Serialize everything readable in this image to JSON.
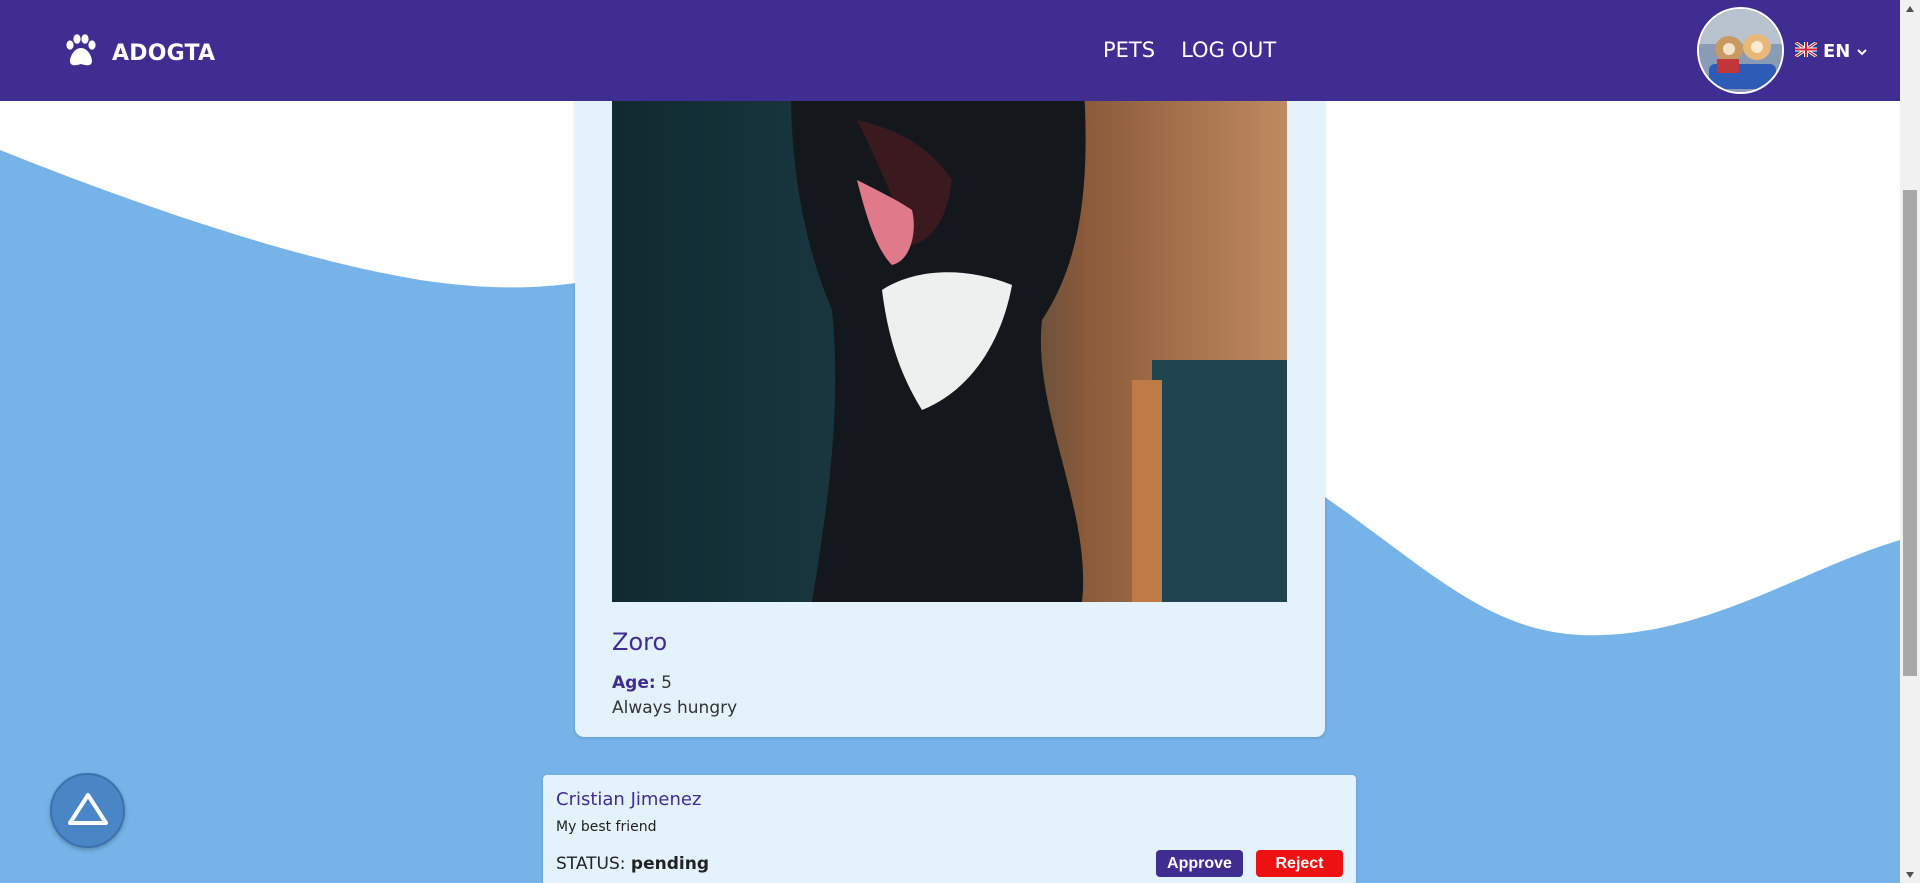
{
  "colors": {
    "nav_bg": "#3f2d91",
    "wave_blue": "#76b3e8",
    "card_bg": "#e4f2fc",
    "approve": "#3f2d91",
    "reject": "#ee1111"
  },
  "navbar": {
    "brand": "ADOGTA",
    "brand_icon": "paw-icon",
    "links": [
      "PETS",
      "LOG OUT"
    ],
    "language": "EN"
  },
  "pet": {
    "name": "Zoro",
    "age_label": "Age:",
    "age_value": "5",
    "description": "Always hungry"
  },
  "request": {
    "requester": "Cristian Jimenez",
    "message": "My best friend",
    "status_label": "STATUS:",
    "status_value": "pending",
    "approve_label": "Approve",
    "reject_label": "Reject"
  }
}
